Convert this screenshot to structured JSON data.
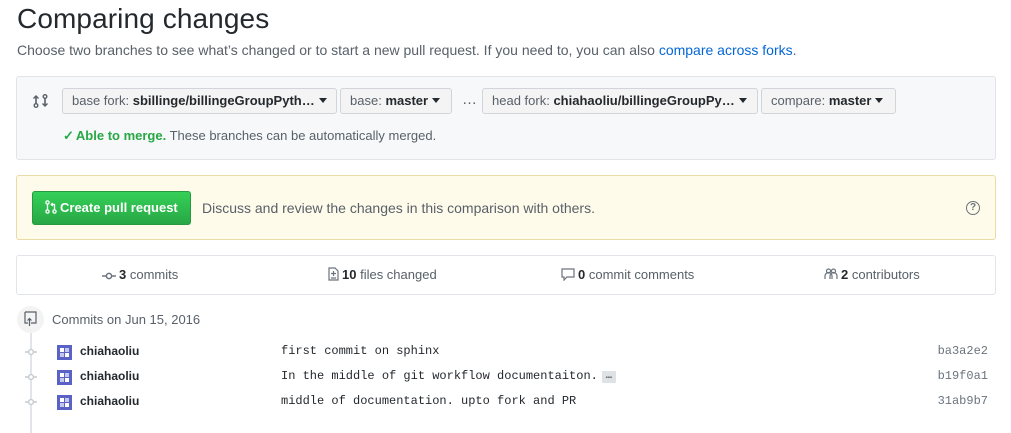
{
  "page": {
    "title": "Comparing changes",
    "subtitle": "Choose two branches to see what’s changed or to start a new pull request. If you need to, you can also ",
    "subtitle_link": "compare across forks",
    "subtitle_end": "."
  },
  "range": {
    "base_fork_label": "base fork:",
    "base_fork_value": "sbillinge/billingeGroupPyth…",
    "base_label": "base:",
    "base_value": "master",
    "dots": "…",
    "head_fork_label": "head fork:",
    "head_fork_value": "chiahaoliu/billingeGroupPy…",
    "compare_label": "compare:",
    "compare_value": "master",
    "merge_status": "Able to merge.",
    "merge_text": " These branches can be automatically merged."
  },
  "flash": {
    "button_label": "Create pull request",
    "text": "Discuss and review the changes in this comparison with others.",
    "help_glyph": "?"
  },
  "stats": {
    "commits_count": "3",
    "commits_label": " commits",
    "files_count": "10",
    "files_label": " files changed",
    "comments_count": "0",
    "comments_label": " commit comments",
    "contributors_count": "2",
    "contributors_label": " contributors"
  },
  "timeline": {
    "date": "Commits on Jun 15, 2016",
    "commits": [
      {
        "author": "chiahaoliu",
        "message": "first commit on sphinx",
        "sha": "ba3a2e2",
        "has_more": false
      },
      {
        "author": "chiahaoliu",
        "message": "In the middle of git workflow documentaiton.",
        "sha": "b19f0a1",
        "has_more": true,
        "more_glyph": "…"
      },
      {
        "author": "chiahaoliu",
        "message": "middle of documentation. upto fork and PR",
        "sha": "31ab9b7",
        "has_more": false
      }
    ]
  },
  "colors": {
    "accent_blue": "#0366d6",
    "success_green": "#28a745",
    "flash_bg": "#fffbea"
  }
}
